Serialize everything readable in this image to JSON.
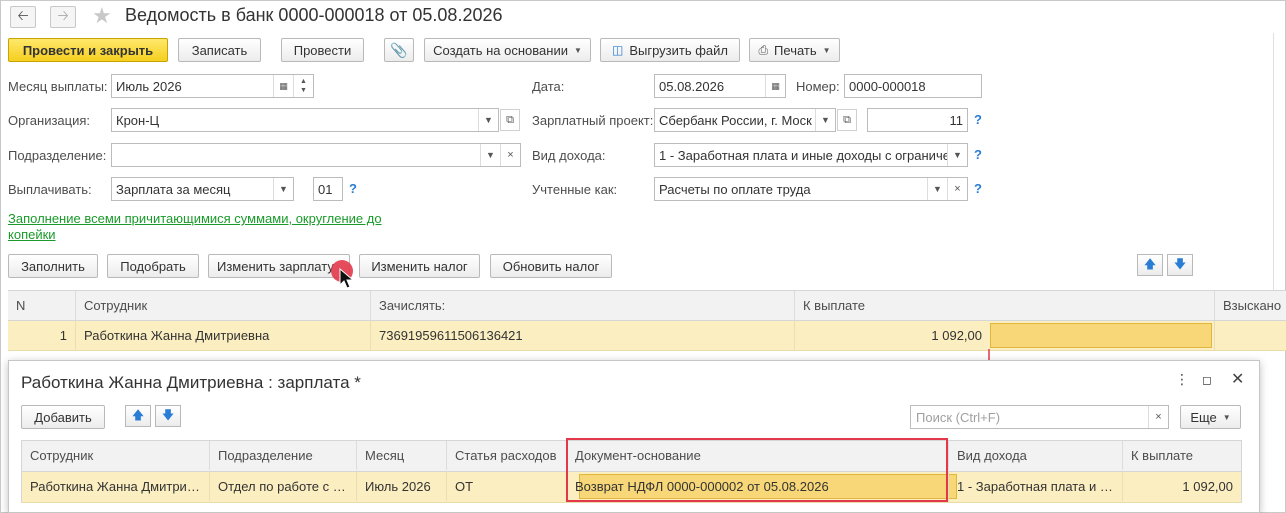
{
  "header": {
    "title": "Ведомость в банк 0000-000018 от 05.08.2026"
  },
  "toolbar": {
    "post_close": "Провести и закрыть",
    "save": "Записать",
    "post": "Провести",
    "create_based": "Создать на основании",
    "export_file": "Выгрузить файл",
    "print": "Печать"
  },
  "form": {
    "month_label": "Месяц выплаты:",
    "month_value": "Июль 2026",
    "date_label": "Дата:",
    "date_value": "05.08.2026",
    "number_label": "Номер:",
    "number_value": "0000-000018",
    "org_label": "Организация:",
    "org_value": "Крон-Ц",
    "project_label": "Зарплатный проект:",
    "project_value": "Сбербанк России, г. Моск",
    "project_count": "11",
    "dept_label": "Подразделение:",
    "dept_value": "",
    "income_label": "Вид дохода:",
    "income_value": "1 - Заработная плата и иные доходы с ограниче",
    "pay_label": "Выплачивать:",
    "pay_value": "Зарплата за месяц",
    "pay_code": "01",
    "account_label": "Учтенные как:",
    "account_value": "Расчеты по оплате труда",
    "help": "?",
    "fill_link": "Заполнение всеми причитающимися суммами, округление до копейки"
  },
  "table_toolbar": {
    "fill": "Заполнить",
    "pick": "Подобрать",
    "change_salary": "Изменить зарплату",
    "change_tax": "Изменить налог",
    "update_tax": "Обновить налог"
  },
  "table": {
    "columns": [
      "N",
      "Сотрудник",
      "Зачислять:",
      "К выплате",
      "Взыскано"
    ],
    "rows": [
      {
        "n": "1",
        "employee": "Работкина Жанна Дмитриевна",
        "account": "7369195961150613642​1",
        "amount": "1 092,00",
        "collected": ""
      }
    ]
  },
  "dialog": {
    "title": "Работкина Жанна Дмитриевна : зарплата *",
    "add": "Добавить",
    "search_placeholder": "Поиск (Ctrl+F)",
    "more": "Еще",
    "columns": [
      "Сотрудник",
      "Подразделение",
      "Месяц",
      "Статья расходов",
      "Документ-основание",
      "Вид дохода",
      "К выплате"
    ],
    "rows": [
      {
        "employee": "Работкина Жанна Дмитри…",
        "dept": "Отдел по работе с …",
        "month": "Июль 2026",
        "expense": "ОТ",
        "doc": "Возврат НДФЛ 0000-000002 от 05.08.2026",
        "income": "1 - Заработная плата и …",
        "amount": "1 092,00"
      }
    ]
  },
  "colors": {
    "primary_button": "#f5cf1f",
    "selected_row": "#fbeec0",
    "selected_cell": "#f7d778",
    "highlight_box": "#e2384a",
    "link": "#1a9a2a",
    "help": "#2a7dd4"
  }
}
